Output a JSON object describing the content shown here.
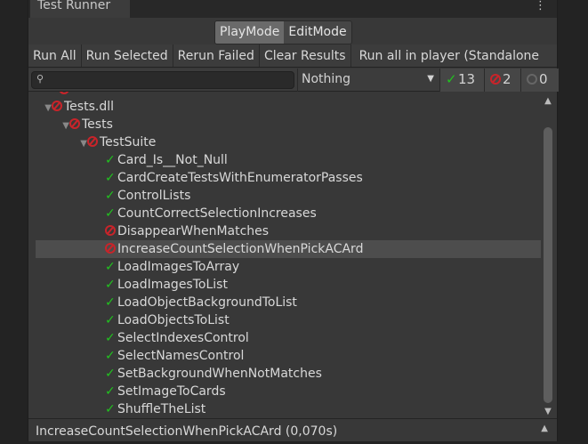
{
  "window": {
    "title": "Test Runner",
    "menu_icon": "kebab-menu-icon"
  },
  "mode_toggle": {
    "items": [
      "PlayMode",
      "EditMode"
    ],
    "active": "PlayMode"
  },
  "toolbar": {
    "buttons": [
      "Run All",
      "Run Selected",
      "Rerun Failed",
      "Clear Results",
      "Run all in player (Standalone"
    ]
  },
  "filter": {
    "search_value": "",
    "search_icon": "magnifier-icon",
    "category": "Nothing",
    "passed": "13",
    "failed": "2",
    "skipped": "0"
  },
  "colors": {
    "pass": "#21c21f",
    "fail": "#c8242a",
    "selected_row": "#4d4d4d"
  },
  "tree": [
    {
      "label": "Tests.dll",
      "status": "fail",
      "depth": 0,
      "expanded": true
    },
    {
      "label": "Tests",
      "status": "fail",
      "depth": 1,
      "expanded": true
    },
    {
      "label": "TestSuite",
      "status": "fail",
      "depth": 2,
      "expanded": true
    },
    {
      "label": "Card_Is__Not_Null",
      "status": "pass",
      "depth": 3
    },
    {
      "label": "CardCreateTestsWithEnumeratorPasses",
      "status": "pass",
      "depth": 3
    },
    {
      "label": "ControlLists",
      "status": "pass",
      "depth": 3
    },
    {
      "label": "CountCorrectSelectionIncreases",
      "status": "pass",
      "depth": 3
    },
    {
      "label": "DisappearWhenMatches",
      "status": "fail",
      "depth": 3
    },
    {
      "label": "IncreaseCountSelectionWhenPickACArd",
      "status": "fail",
      "depth": 3,
      "selected": true
    },
    {
      "label": "LoadImagesToArray",
      "status": "pass",
      "depth": 3
    },
    {
      "label": "LoadImagesToList",
      "status": "pass",
      "depth": 3
    },
    {
      "label": "LoadObjectBackgroundToList",
      "status": "pass",
      "depth": 3
    },
    {
      "label": "LoadObjectsToList",
      "status": "pass",
      "depth": 3
    },
    {
      "label": "SelectIndexesControl",
      "status": "pass",
      "depth": 3
    },
    {
      "label": "SelectNamesControl",
      "status": "pass",
      "depth": 3
    },
    {
      "label": "SetBackgroundWhenNotMatches",
      "status": "pass",
      "depth": 3
    },
    {
      "label": "SetImageToCards",
      "status": "pass",
      "depth": 3
    },
    {
      "label": "ShuffleTheList",
      "status": "pass",
      "depth": 3
    }
  ],
  "status_bar": {
    "text": "IncreaseCountSelectionWhenPickACArd (0,070s)"
  }
}
